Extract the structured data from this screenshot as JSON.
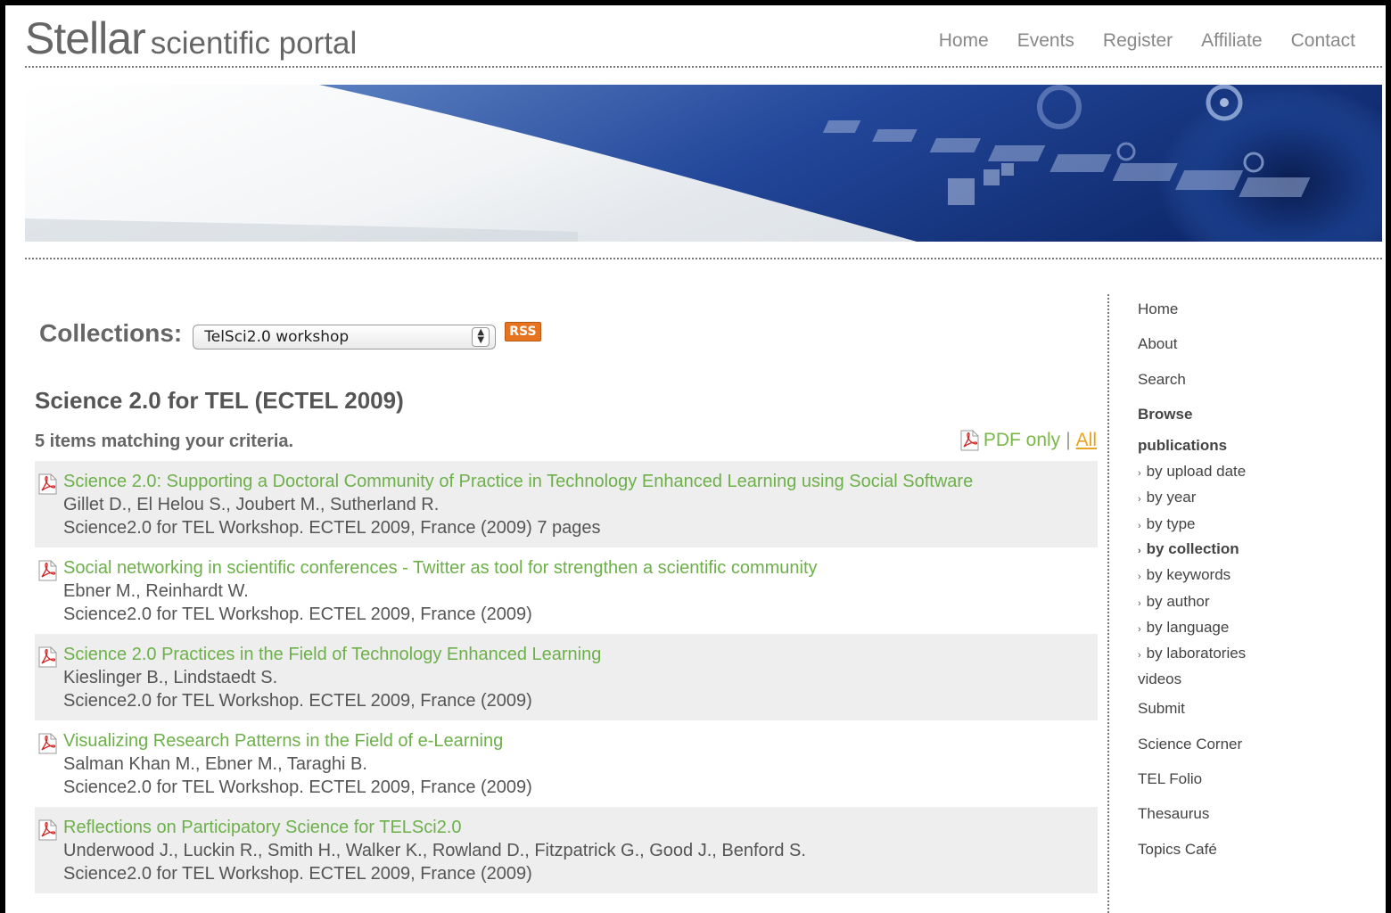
{
  "brand": {
    "name": "Stellar",
    "tagline": "scientific portal"
  },
  "top_nav": [
    "Home",
    "Events",
    "Register",
    "Affiliate",
    "Contact"
  ],
  "collections": {
    "label": "Collections:",
    "selected": "TelSci2.0 workshop",
    "rss_label": "RSS"
  },
  "section_title": "Science 2.0 for TEL (ECTEL 2009)",
  "match_text": "5 items matching your criteria.",
  "filter": {
    "pdf_only": "PDF only",
    "separator": "|",
    "all": "All"
  },
  "items": [
    {
      "title": "Science 2.0: Supporting a Doctoral Community of Practice in Technology Enhanced Learning using Social Software",
      "authors": "Gillet D., El Helou S., Joubert M., Sutherland R.",
      "source": "Science2.0 for TEL Workshop. ECTEL 2009, France (2009) 7 pages"
    },
    {
      "title": "Social networking in scientific conferences - Twitter as tool for strengthen a scientific community",
      "authors": "Ebner M., Reinhardt W.",
      "source": "Science2.0 for TEL Workshop. ECTEL 2009, France (2009)"
    },
    {
      "title": "Science 2.0 Practices in the Field of Technology Enhanced Learning",
      "authors": "Kieslinger B., Lindstaedt S.",
      "source": "Science2.0 for TEL Workshop. ECTEL 2009, France (2009)"
    },
    {
      "title": "Visualizing Research Patterns in the Field of e-Learning",
      "authors": "Salman Khan M., Ebner M., Taraghi B.",
      "source": "Science2.0 for TEL Workshop. ECTEL 2009, France (2009)"
    },
    {
      "title": "Reflections on Participatory Science for TELSci2.0",
      "authors": "Underwood J., Luckin R., Smith H., Walker K., Rowland D., Fitzpatrick G., Good J., Benford S.",
      "source": "Science2.0 for TEL Workshop. ECTEL 2009, France (2009)"
    }
  ],
  "sidebar": {
    "home": "Home",
    "about": "About",
    "search": "Search",
    "browse": "Browse",
    "publications": "publications",
    "by_upload_date": "by upload date",
    "by_year": "by year",
    "by_type": "by type",
    "by_collection": "by collection",
    "by_keywords": "by keywords",
    "by_author": "by author",
    "by_language": "by language",
    "by_laboratories": "by laboratories",
    "videos": "videos",
    "submit": "Submit",
    "science_corner": "Science Corner",
    "tel_folio": "TEL Folio",
    "thesaurus": "Thesaurus",
    "topics_cafe": "Topics Café"
  }
}
